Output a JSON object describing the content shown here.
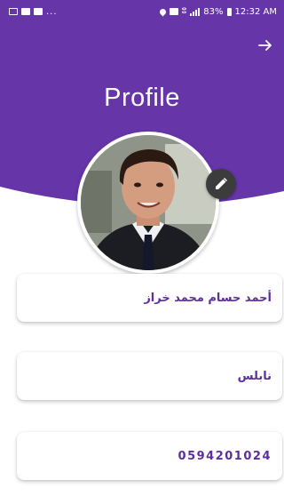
{
  "theme": {
    "primary": "#6635a8",
    "accent_text": "#5b2f9e",
    "fab": "#3c3c3c"
  },
  "status_bar": {
    "battery": "83%",
    "time": "12:32 AM",
    "notification_dots": "..."
  },
  "header": {
    "title": "Profile",
    "nav_icon": "arrow-right-icon"
  },
  "profile": {
    "edit_icon": "pencil-icon",
    "name": "أحمد حسام محمد خراز",
    "city": "نابلس",
    "phone": "0594201024"
  }
}
